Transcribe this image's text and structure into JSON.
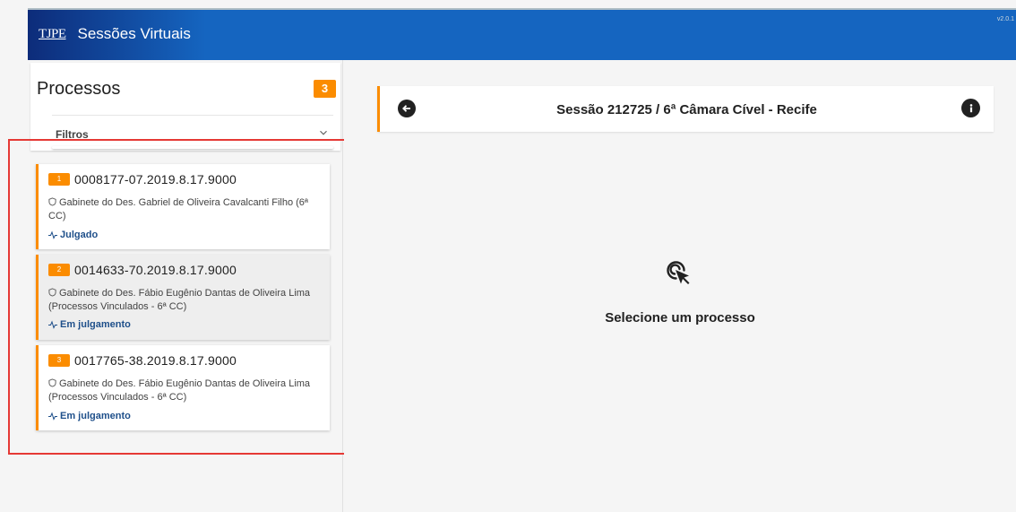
{
  "header": {
    "logo": "TJPE",
    "title": "Sessões Virtuais",
    "version": "v2.0.1",
    "color": "#1565c0"
  },
  "sidebar": {
    "title": "Processos",
    "count": "3",
    "filters_label": "Filtros",
    "accent": "#fb8c00",
    "processes": [
      {
        "index": "1",
        "number": "0008177-07.2019.8.17.9000",
        "office": "Gabinete do Des. Gabriel de Oliveira Cavalcanti Filho (6ª CC)",
        "status": "Julgado",
        "selected": false
      },
      {
        "index": "2",
        "number": "0014633-70.2019.8.17.9000",
        "office": "Gabinete do Des. Fábio Eugênio Dantas de Oliveira Lima (Processos Vinculados - 6ª CC)",
        "status": "Em julgamento",
        "selected": true
      },
      {
        "index": "3",
        "number": "0017765-38.2019.8.17.9000",
        "office": "Gabinete do Des. Fábio Eugênio Dantas de Oliveira Lima (Processos Vinculados - 6ª CC)",
        "status": "Em julgamento",
        "selected": false
      }
    ]
  },
  "main": {
    "session_title": "Sessão 212725 / 6ª Câmara Cível - Recife",
    "empty_message": "Selecione um processo",
    "icons": {
      "back": "arrow-left-circle-icon",
      "info": "info-circle-icon",
      "empty": "cursor-click-icon"
    }
  }
}
